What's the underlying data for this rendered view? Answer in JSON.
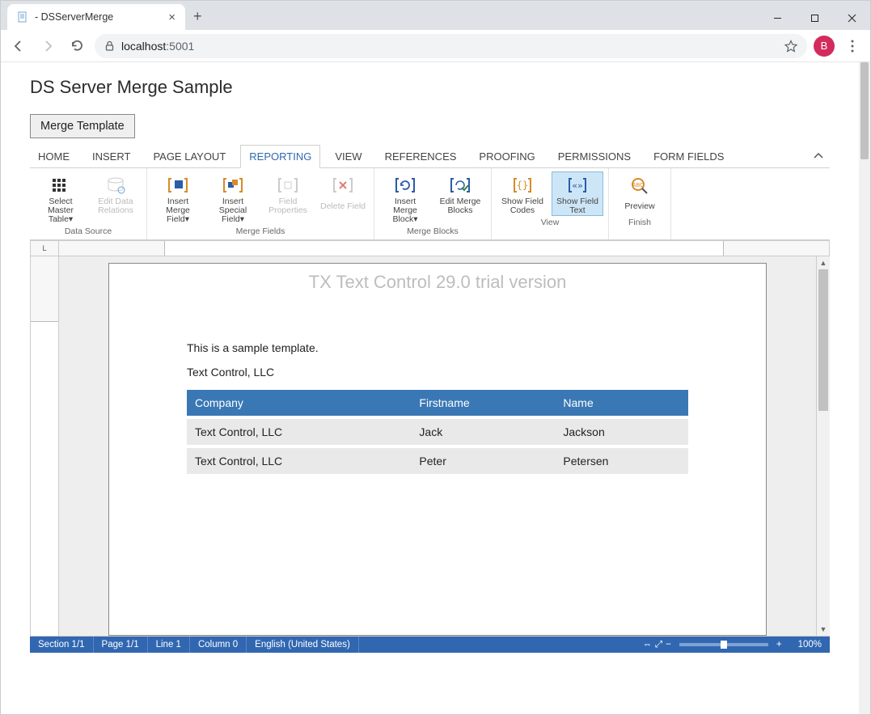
{
  "browser": {
    "tab_title": " - DSServerMerge",
    "url_host": "localhost",
    "url_port": ":5001",
    "avatar_letter": "B"
  },
  "page": {
    "title": "DS Server Merge Sample",
    "merge_button": "Merge Template"
  },
  "tabs": {
    "items": [
      "HOME",
      "INSERT",
      "PAGE LAYOUT",
      "REPORTING",
      "VIEW",
      "REFERENCES",
      "PROOFING",
      "PERMISSIONS",
      "FORM FIELDS"
    ],
    "active_index": 3
  },
  "ribbon": {
    "groups": [
      {
        "label": "Data Source",
        "buttons": [
          {
            "label": "Select Master Table▾",
            "icon": "grid"
          },
          {
            "label": "Edit Data Relations",
            "icon": "db",
            "disabled": true
          }
        ]
      },
      {
        "label": "Merge Fields",
        "buttons": [
          {
            "label": "Insert Merge Field▾",
            "icon": "bracket-orange"
          },
          {
            "label": "Insert Special Field▾",
            "icon": "bracket-blue"
          },
          {
            "label": "Field Properties",
            "icon": "bracket-gray",
            "disabled": true
          },
          {
            "label": "Delete Field",
            "icon": "bracket-x",
            "disabled": true
          }
        ]
      },
      {
        "label": "Merge Blocks",
        "buttons": [
          {
            "label": "Insert Merge Block▾",
            "icon": "block-cycle"
          },
          {
            "label": "Edit Merge Blocks",
            "icon": "block-check"
          }
        ]
      },
      {
        "label": "View",
        "buttons": [
          {
            "label": "Show Field Codes",
            "icon": "codes"
          },
          {
            "label": "Show Field Text",
            "icon": "fieldtext",
            "active": true
          }
        ]
      },
      {
        "label": "Finish",
        "buttons": [
          {
            "label": "Preview",
            "icon": "magnify"
          }
        ]
      }
    ]
  },
  "document": {
    "watermark": "TX Text Control 29.0 trial version",
    "lines": [
      "This is a sample template.",
      "Text Control, LLC"
    ],
    "table": {
      "headers": [
        "Company",
        "Firstname",
        "Name"
      ],
      "rows": [
        [
          "Text Control, LLC",
          "Jack",
          "Jackson"
        ],
        [
          "Text Control, LLC",
          "Peter",
          "Petersen"
        ]
      ]
    }
  },
  "status": {
    "section": "Section 1/1",
    "page": "Page 1/1",
    "line": "Line 1",
    "column": "Column 0",
    "lang": "English (United States)",
    "zoom": "100%"
  }
}
